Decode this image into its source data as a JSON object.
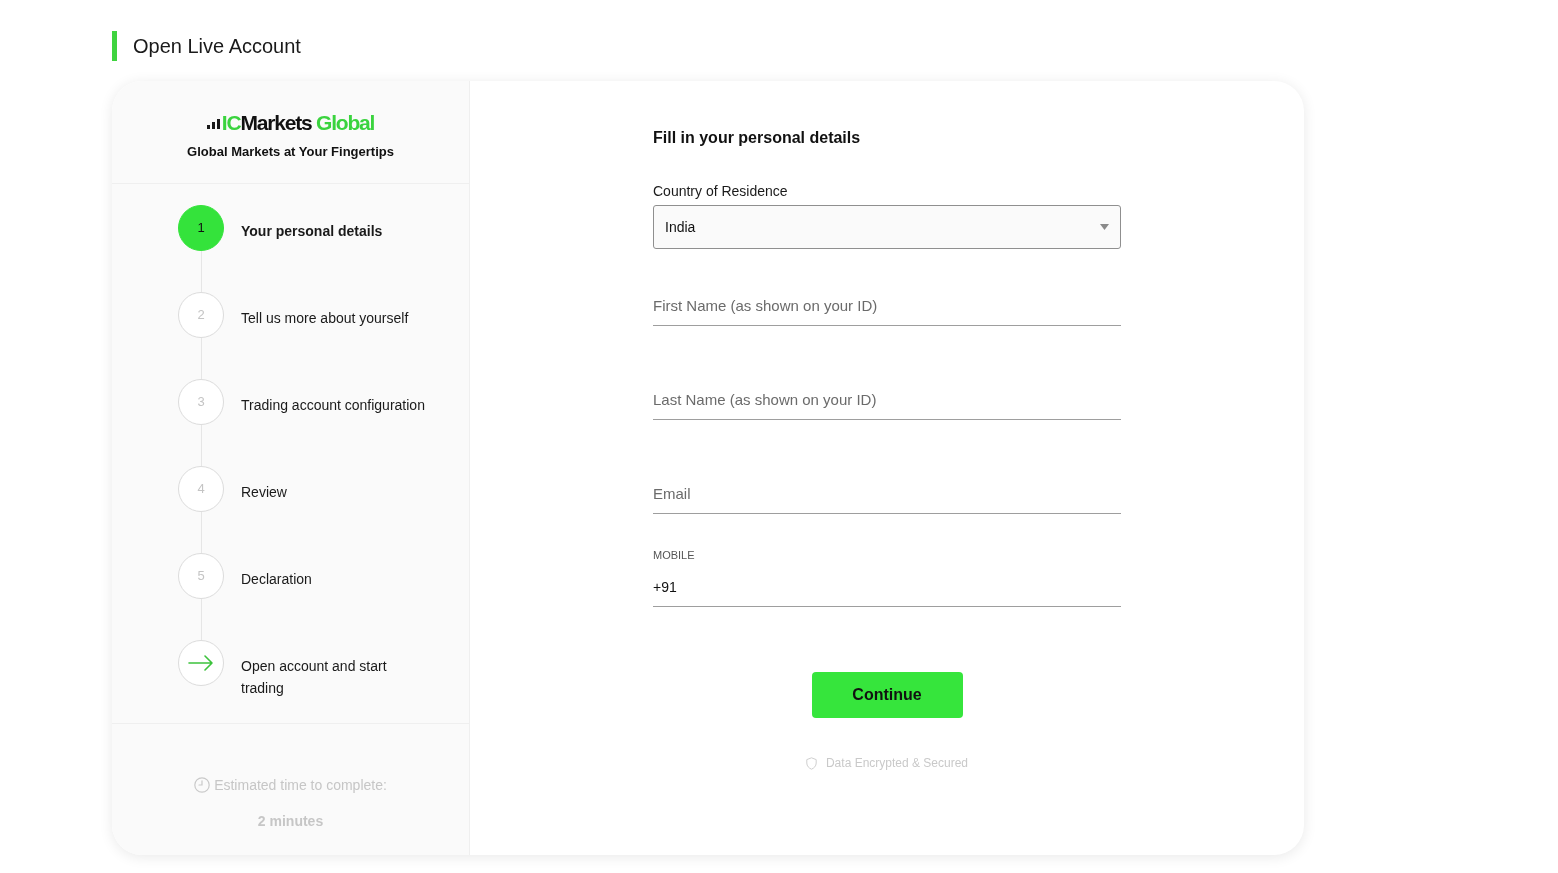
{
  "page": {
    "title": "Open Live Account"
  },
  "sidebar": {
    "logo": {
      "prefix": "IC",
      "name": "Markets",
      "suffix": "Global"
    },
    "tagline": "Global Markets at Your Fingertips",
    "steps": [
      {
        "kind": "number",
        "number": "1",
        "label": "Your personal details",
        "active": true
      },
      {
        "kind": "number",
        "number": "2",
        "label": "Tell us more about yourself",
        "active": false
      },
      {
        "kind": "number",
        "number": "3",
        "label": "Trading account configuration",
        "active": false
      },
      {
        "kind": "number",
        "number": "4",
        "label": "Review",
        "active": false
      },
      {
        "kind": "number",
        "number": "5",
        "label": "Declaration",
        "active": false
      },
      {
        "kind": "arrow",
        "label": "Open account and start trading",
        "active": false
      }
    ],
    "estimate": {
      "label": "Estimated time to complete:",
      "value": "2 minutes"
    }
  },
  "form": {
    "heading": "Fill in your personal details",
    "country": {
      "label": "Country of Residence",
      "value": "India"
    },
    "fields": [
      {
        "kind": "text",
        "placeholder": "First Name (as shown on your ID)"
      },
      {
        "kind": "text",
        "placeholder": "Last Name (as shown on your ID)"
      },
      {
        "kind": "text",
        "placeholder": "Email"
      },
      {
        "kind": "phone",
        "label": "MOBILE",
        "value": "+91"
      }
    ],
    "submit": "Continue",
    "security_note": "Data Encrypted & Secured"
  }
}
